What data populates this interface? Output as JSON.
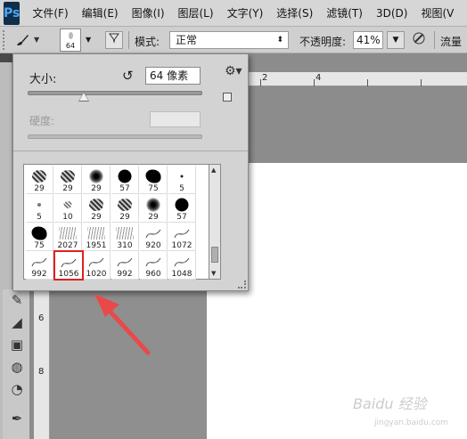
{
  "app": {
    "logo": "Ps"
  },
  "menubar": {
    "items": [
      "文件(F)",
      "编辑(E)",
      "图像(I)",
      "图层(L)",
      "文字(Y)",
      "选择(S)",
      "滤镜(T)",
      "3D(D)",
      "视图(V"
    ]
  },
  "optionsbar": {
    "preset_size": "64",
    "mode_label": "模式:",
    "mode_value": "正常",
    "opacity_label": "不透明度:",
    "opacity_value": "41%",
    "flow_label": "流量"
  },
  "brush_popup": {
    "size_label": "大小:",
    "size_value": "64 像素",
    "size_fraction": 0.32,
    "hardness_label": "硬度:",
    "brushes": [
      {
        "size": "29",
        "kind": "texture"
      },
      {
        "size": "29",
        "kind": "texture"
      },
      {
        "size": "29",
        "kind": "soft"
      },
      {
        "size": "57",
        "kind": "hard"
      },
      {
        "size": "75",
        "kind": "splat"
      },
      {
        "size": "5",
        "kind": "dot"
      },
      {
        "size": "5",
        "kind": "dot-soft"
      },
      {
        "size": "10",
        "kind": "texture-small"
      },
      {
        "size": "29",
        "kind": "texture"
      },
      {
        "size": "29",
        "kind": "texture"
      },
      {
        "size": "29",
        "kind": "soft"
      },
      {
        "size": "57",
        "kind": "hard"
      },
      {
        "size": "75",
        "kind": "splat"
      },
      {
        "size": "2027",
        "kind": "sketch"
      },
      {
        "size": "1951",
        "kind": "sketch"
      },
      {
        "size": "310",
        "kind": "sketch"
      },
      {
        "size": "920",
        "kind": "stroke"
      },
      {
        "size": "1072",
        "kind": "stroke"
      },
      {
        "size": "992",
        "kind": "stroke"
      },
      {
        "size": "1056",
        "kind": "stroke",
        "selected": true
      },
      {
        "size": "1020",
        "kind": "stroke"
      },
      {
        "size": "992",
        "kind": "stroke"
      },
      {
        "size": "960",
        "kind": "stroke"
      },
      {
        "size": "1048",
        "kind": "stroke"
      }
    ]
  },
  "ruler_top": {
    "ticks": [
      "2",
      "4"
    ]
  },
  "ruler_left": {
    "ticks": [
      "6",
      "8"
    ]
  },
  "watermark": {
    "text": "Baidu 经验",
    "sub": "jingyan.baidu.com"
  },
  "colors": {
    "highlight": "#e02020",
    "arrow": "#e84a4a"
  }
}
